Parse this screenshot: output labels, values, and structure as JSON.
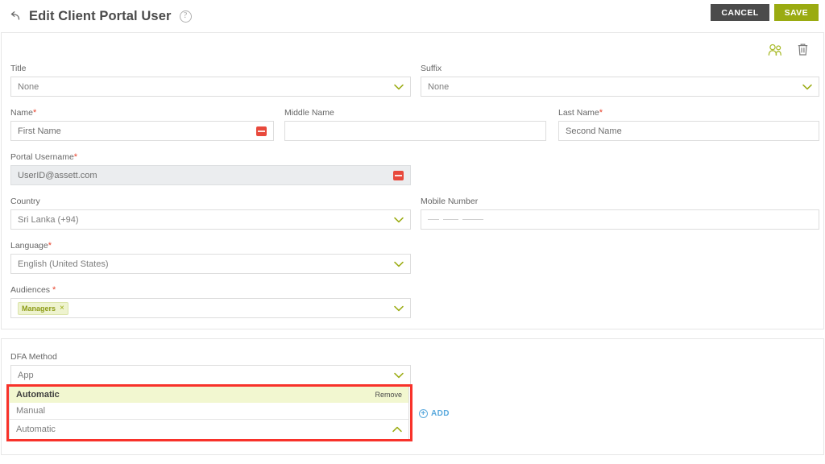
{
  "header": {
    "back_icon": "back-arrow-icon",
    "title": "Edit Client Portal User",
    "help_icon": "help-circle-icon",
    "cancel_label": "CANCEL",
    "save_label": "SAVE",
    "save_color": "#9aab11",
    "cancel_color": "#4b4b4b"
  },
  "profile_card": {
    "icons": {
      "users_icon": "users-icon",
      "users_icon_color": "#9aab11",
      "delete_icon": "trash-icon",
      "delete_icon_color": "#7a7a7a"
    },
    "fields": {
      "title": {
        "label": "Title",
        "value": "None",
        "type": "select"
      },
      "suffix": {
        "label": "Suffix",
        "value": "None",
        "type": "select"
      },
      "name": {
        "label": "Name",
        "required": "*",
        "value": "First Name",
        "type": "input",
        "badge": "red-mask-badge"
      },
      "middle_name": {
        "label": "Middle Name",
        "value": "",
        "type": "input"
      },
      "last_name": {
        "label": "Last Name",
        "required": "*",
        "value": "Second Name",
        "type": "input"
      },
      "portal_username": {
        "label": "Portal Username",
        "required": "*",
        "value": "UserID@assett.com",
        "type": "input",
        "disabled": true,
        "badge": "red-mask-badge"
      },
      "country": {
        "label": "Country",
        "value": "Sri Lanka (+94)",
        "type": "select"
      },
      "mobile_number": {
        "label": "Mobile Number",
        "value": "",
        "placeholder": "___ ___ ____",
        "type": "input"
      },
      "language": {
        "label": "Language",
        "required": "*",
        "value": "English (United States)",
        "type": "select"
      },
      "audiences": {
        "label": "Audiences",
        "required": "*",
        "type": "multiselect",
        "chip_label": "Managers",
        "chip_remove": "×"
      }
    }
  },
  "dfa_card": {
    "label": "DFA Method",
    "value": "App",
    "dropdown": {
      "options": [
        {
          "label": "Automatic",
          "selected": true,
          "action_label": "Remove"
        },
        {
          "label": "Manual",
          "selected": false
        }
      ],
      "field_value": "Automatic",
      "collapse_icon": "chevron-up-icon",
      "highlight_color": "#f8322a",
      "selected_row_color": "#f2f7d0"
    },
    "add_label": "ADD",
    "add_icon": "plus-circle-icon",
    "add_color": "#5aa9dd"
  }
}
